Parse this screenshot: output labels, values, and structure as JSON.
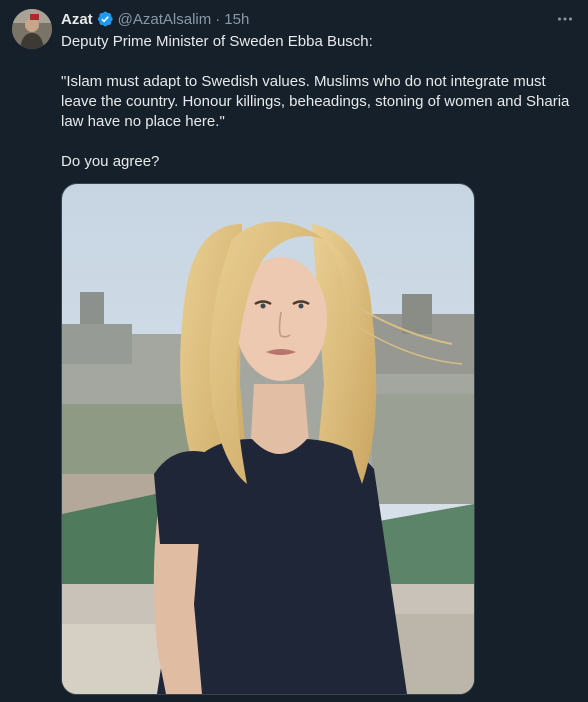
{
  "tweet": {
    "author_name": "Azat",
    "author_handle": "@AzatAlsalim",
    "separator": "·",
    "time": "15h",
    "text_line1": "Deputy Prime Minister of Sweden Ebba Busch:",
    "text_line2": "\"Islam must adapt to Swedish values. Muslims who do not integrate must leave the country. Honour killings, beheadings, stoning of women and Sharia law have no place here.\"",
    "text_line3": "Do you agree?"
  },
  "icons": {
    "verified": "verified-badge-icon",
    "more": "more-options-icon"
  },
  "colors": {
    "background": "#15202b",
    "text": "#e7e9ea",
    "secondary_text": "#8b98a5",
    "verified_blue": "#1d9bf0",
    "border": "#38444d"
  }
}
